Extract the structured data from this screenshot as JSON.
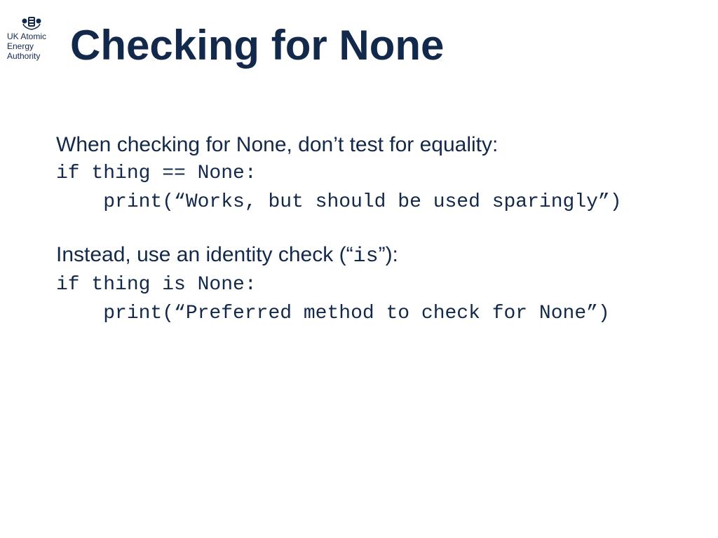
{
  "logo": {
    "line1": "UK Atomic",
    "line2": "Energy",
    "line3": "Authority"
  },
  "title": "Checking for None",
  "body": {
    "para1": "When checking for None, don’t test for equality:",
    "code1_line1": "if thing == None:",
    "code1_line2": "    print(“Works, but should be used sparingly”)",
    "para2_pre": "Instead, use an identity check (“",
    "para2_code": "is",
    "para2_post": "”):",
    "code2_line1": "if thing is None:",
    "code2_line2": "    print(“Preferred method to check for None”)"
  }
}
